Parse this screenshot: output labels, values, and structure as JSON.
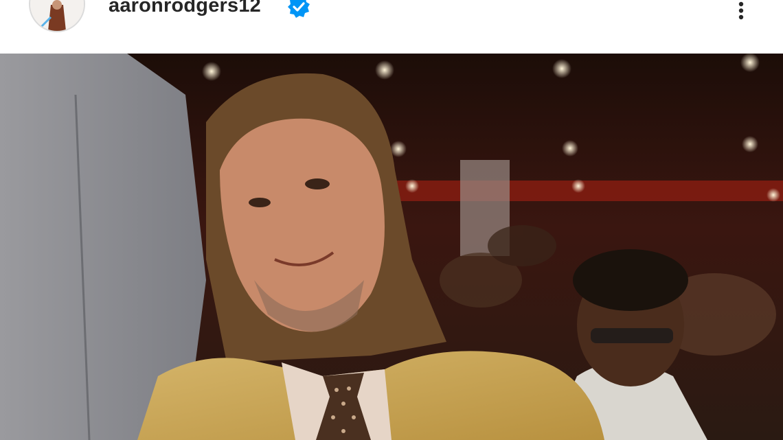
{
  "post_header": {
    "username": "aaronrodgers12",
    "verified": true,
    "avatar_icon": "profile-avatar",
    "verified_icon": "verified-badge-icon",
    "more_icon": "more-options-icon",
    "colors": {
      "username": "#262626",
      "verified_badge": "#0095f6",
      "background": "#ffffff"
    }
  },
  "post_image": {
    "icon": "photo"
  }
}
